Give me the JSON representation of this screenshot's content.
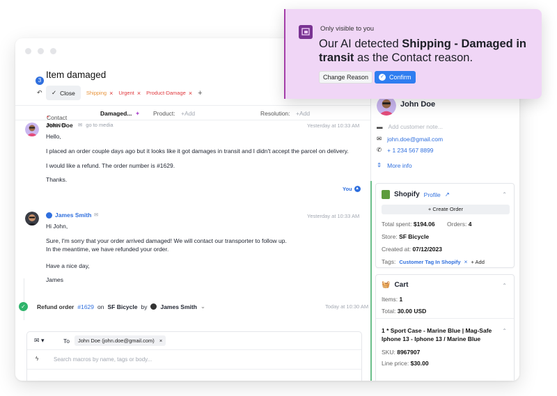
{
  "ticket": {
    "title": "Item damaged",
    "notification_count": "3",
    "close_label": "Close",
    "tags": [
      "Shipping",
      "Urgent",
      "Product-Damage"
    ],
    "tag_colors": [
      "#e8933a",
      "#e0393e",
      "#e0393e"
    ]
  },
  "fields": {
    "contact_reason_label": "Contact reason:",
    "contact_reason_value": "Damaged...",
    "product_label": "Product:",
    "product_add": "+Add",
    "resolution_label": "Resolution:",
    "resolution_add": "+Add"
  },
  "messages": [
    {
      "sender": "John Doe",
      "via": "go to media",
      "time": "Yesterday at 10:33 AM",
      "lines": [
        "Hello,",
        "I placed an order couple days ago but it looks like it got damages in transit and I didn't accept the parcel on delivery.",
        "I would like a refund. The order number is #1629.",
        "Thanks."
      ]
    },
    {
      "sender": "James Smith",
      "time": "Yesterday at 10:33 AM",
      "lines": [
        "Hi John,",
        "Sure, I'm sorry that your order arrived damaged! We will contact our transporter to follow up.",
        "In the meantime, we have refunded your order.",
        "Have a nice day,",
        "James"
      ]
    }
  ],
  "you_label": "You",
  "refund": {
    "text": "Refund order",
    "order": "#1629",
    "on": "on",
    "store": "SF Bicycle",
    "by": "by",
    "agent": "James Smith",
    "time": "Today at 10:30 AM"
  },
  "compose": {
    "to_label": "To",
    "recipient": "John Doe (john.doe@gmail.com)",
    "macro_placeholder": "Search macros by name, tags or body..."
  },
  "customer": {
    "name": "John Doe",
    "note_placeholder": "Add customer note...",
    "email": "john.doe@gmail.com",
    "phone": "+ 1 234 567 8899",
    "more_info": "More info"
  },
  "shopify": {
    "title": "Shopify",
    "profile": "Profile",
    "create_order": "+ Create Order",
    "total_spent_label": "Total spent:",
    "total_spent": "$194.06",
    "orders_label": "Orders:",
    "orders": "4",
    "store_label": "Store:",
    "store": "SF Bicycle",
    "created_label": "Created at:",
    "created": "07/12/2023",
    "tags_label": "Tags:",
    "tag": "Customer Tag In Shopify",
    "add_tag": "+ Add"
  },
  "cart": {
    "title": "Cart",
    "items_label": "Items:",
    "items": "1",
    "total_label": "Total:",
    "total": "30.00 USD",
    "product": "1 * Sport Case - Marine Blue | Mag-Safe Iphone 13 - Iphone 13 / Marine Blue",
    "sku_label": "SKU:",
    "sku": "8967907",
    "price_label": "Line price:",
    "price": "$30.00"
  },
  "popup": {
    "visibility": "Only visible to you",
    "msg_pre": "Our AI detected ",
    "msg_bold": "Shipping - Damaged in transit",
    "msg_post": " as the Contact reason.",
    "change_label": "Change Reason",
    "confirm_label": "Confirm"
  }
}
